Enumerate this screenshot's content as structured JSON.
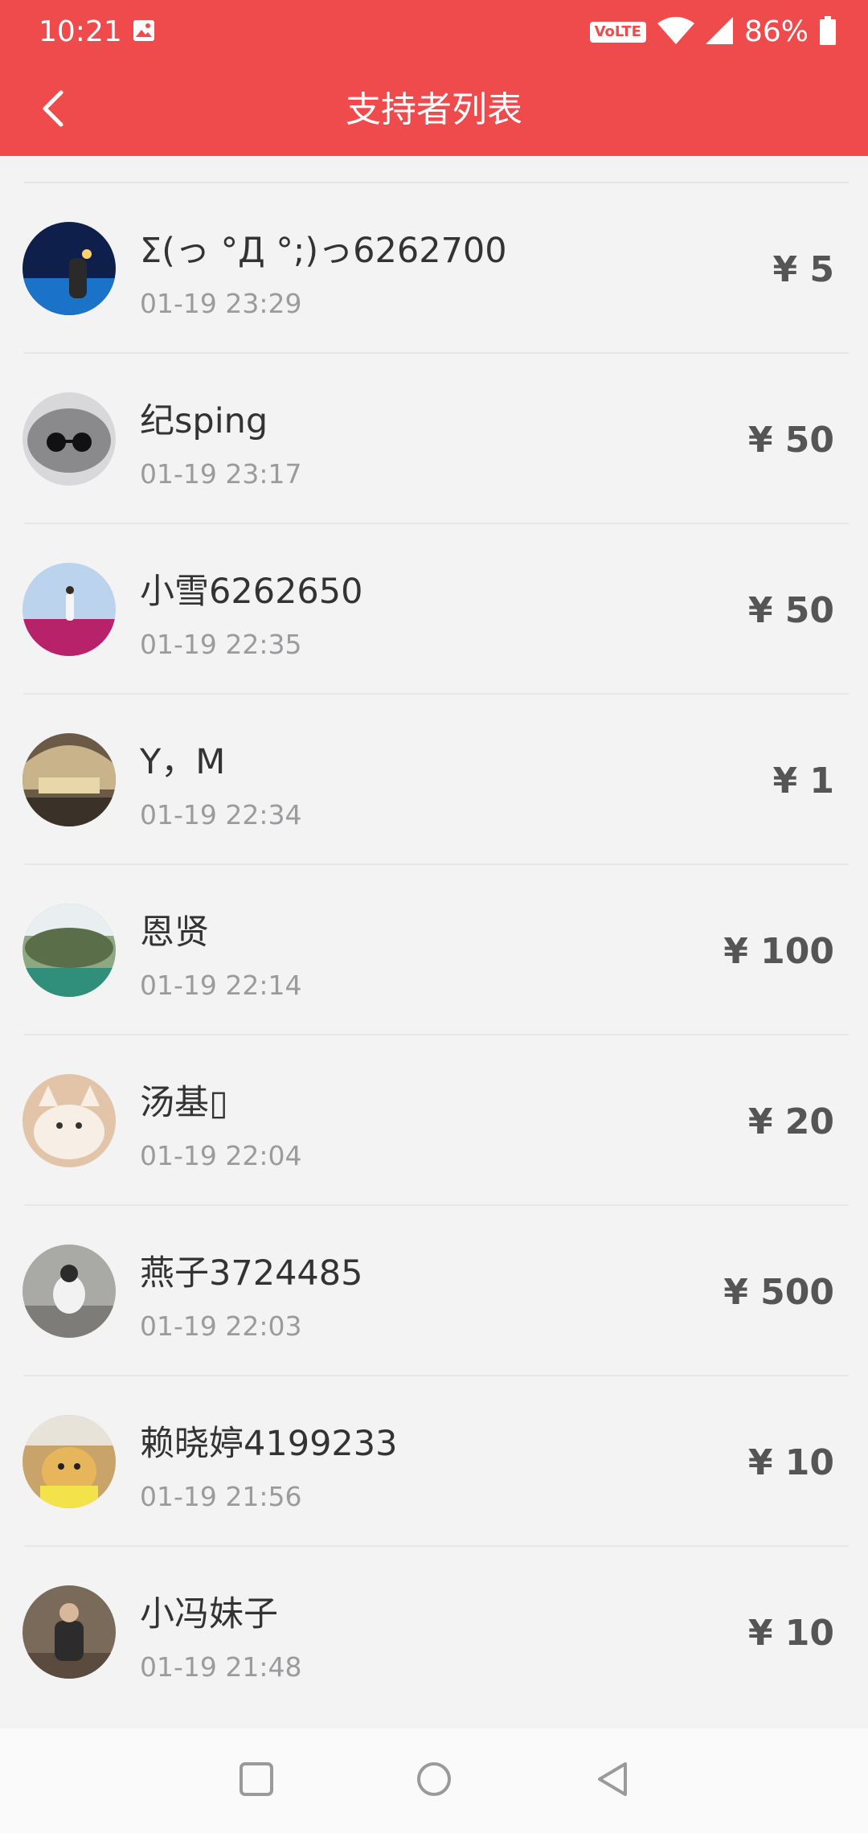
{
  "status_bar": {
    "time": "10:21",
    "network_badge": "VoLTE",
    "battery": "86%",
    "icons": [
      "image-icon",
      "wifi-icon",
      "signal-icon",
      "battery-icon"
    ]
  },
  "app_bar": {
    "title": "支持者列表",
    "back_icon": "back-arrow-icon",
    "color": "#ef4a4c"
  },
  "supporters": [
    {
      "name": "Σ(っ °Д °;)っ6262700",
      "time": "01-19 23:29",
      "amount": "¥ 5"
    },
    {
      "name": "纪sping",
      "time": "01-19 23:17",
      "amount": "¥ 50"
    },
    {
      "name": "小雪6262650",
      "time": "01-19 22:35",
      "amount": "¥ 50"
    },
    {
      "name": "Y，M",
      "time": "01-19 22:34",
      "amount": "¥ 1"
    },
    {
      "name": "恩贤",
      "time": "01-19 22:14",
      "amount": "¥ 100"
    },
    {
      "name": "汤基▯",
      "time": "01-19 22:04",
      "amount": "¥ 20"
    },
    {
      "name": "燕子3724485",
      "time": "01-19 22:03",
      "amount": "¥ 500"
    },
    {
      "name": "赖晓婷4199233",
      "time": "01-19 21:56",
      "amount": "¥ 10"
    },
    {
      "name": "小冯妹子",
      "time": "01-19 21:48",
      "amount": "¥ 10"
    }
  ],
  "nav_bar": {
    "buttons": [
      "recents-square-icon",
      "home-circle-icon",
      "back-triangle-icon"
    ]
  }
}
